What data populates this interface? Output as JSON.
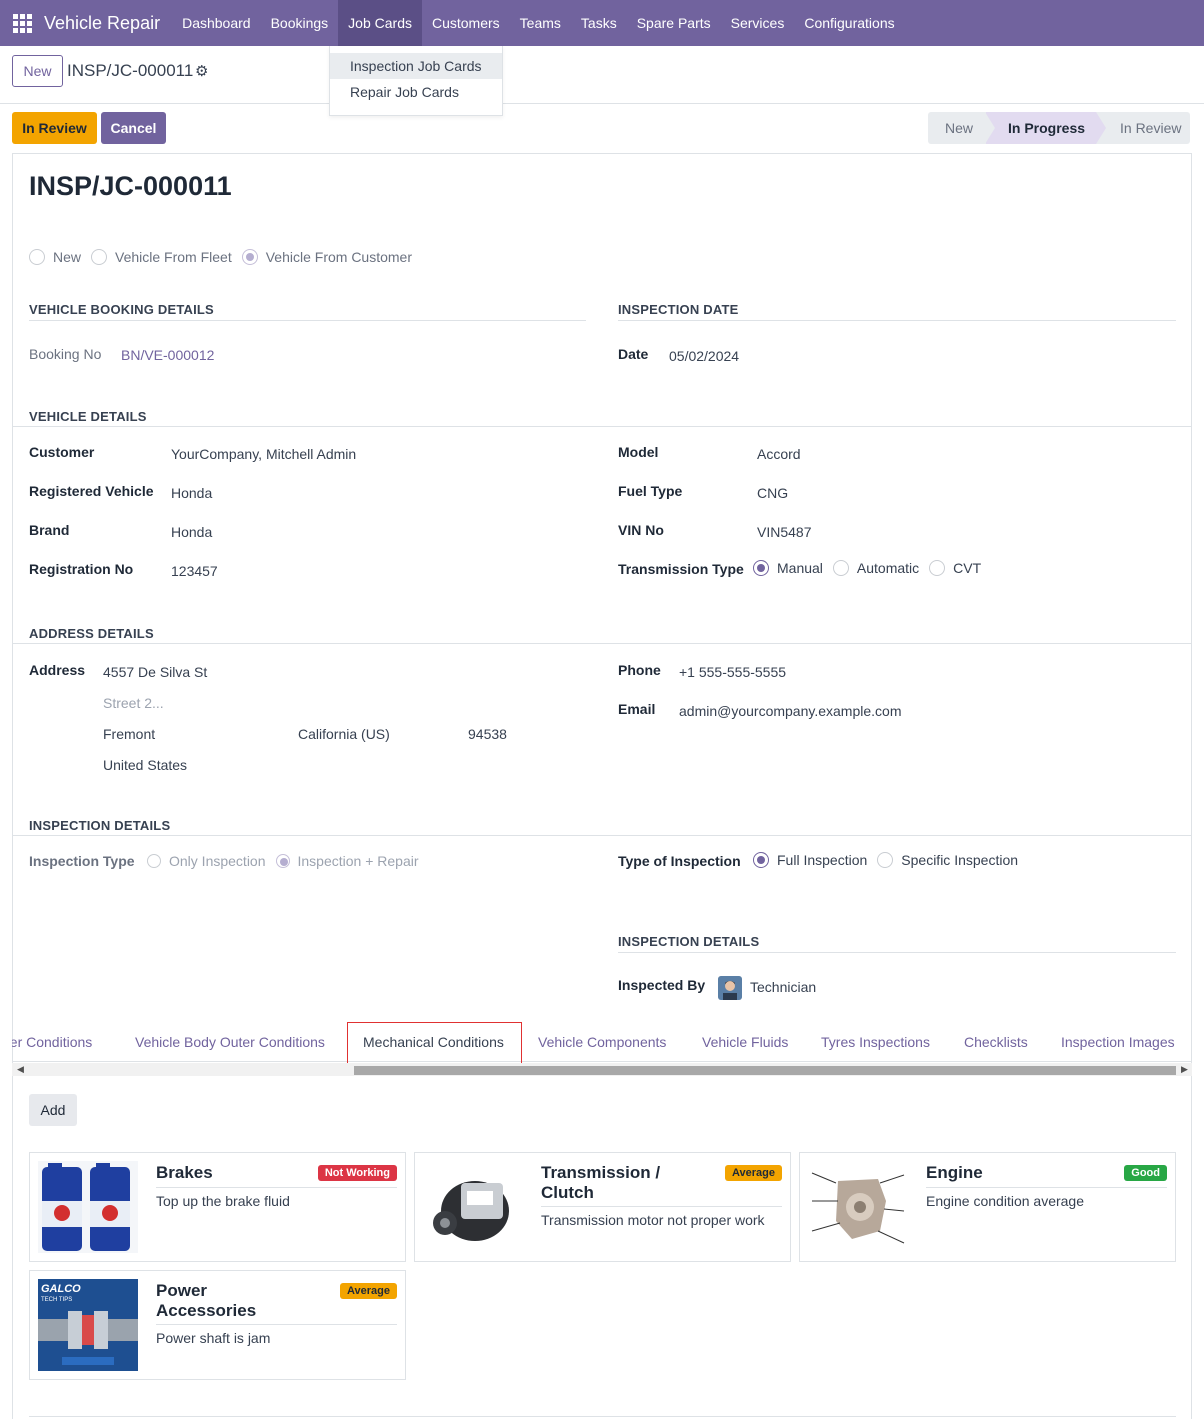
{
  "navbar": {
    "brand": "Vehicle Repair",
    "items": [
      "Dashboard",
      "Bookings",
      "Job Cards",
      "Customers",
      "Teams",
      "Tasks",
      "Spare Parts",
      "Services",
      "Configurations"
    ],
    "active_index": 2
  },
  "dropdown": {
    "items": [
      "Inspection Job Cards",
      "Repair Job Cards"
    ]
  },
  "control_panel": {
    "new_button": "New",
    "breadcrumb": "INSP/JC-000011"
  },
  "actions": {
    "in_review_button": "In Review",
    "cancel_button": "Cancel"
  },
  "statusbar": {
    "stages": [
      "New",
      "In Progress",
      "In Review"
    ],
    "current": "In Progress"
  },
  "record": {
    "title": "INSP/JC-000011",
    "vehicle_source_options": [
      "New",
      "Vehicle From Fleet",
      "Vehicle From Customer"
    ],
    "vehicle_source_selected": "Vehicle From Customer"
  },
  "booking": {
    "section": "VEHICLE BOOKING DETAILS",
    "booking_no_label": "Booking No",
    "booking_no": "BN/VE-000012"
  },
  "inspection_date": {
    "section": "INSPECTION DATE",
    "date_label": "Date",
    "date": "05/02/2024"
  },
  "vehicle": {
    "section": "VEHICLE DETAILS",
    "customer_label": "Customer",
    "customer": "YourCompany, Mitchell Admin",
    "registered_label": "Registered Vehicle",
    "registered": "Honda",
    "brand_label": "Brand",
    "brand": "Honda",
    "registration_label": "Registration No",
    "registration": "123457",
    "model_label": "Model",
    "model": "Accord",
    "fuel_label": "Fuel Type",
    "fuel": "CNG",
    "vin_label": "VIN No",
    "vin": "VIN5487",
    "transmission_label": "Transmission Type",
    "transmission_options": [
      "Manual",
      "Automatic",
      "CVT"
    ],
    "transmission_selected": "Manual"
  },
  "address": {
    "section": "ADDRESS DETAILS",
    "address_label": "Address",
    "street": "4557 De Silva St",
    "street2_placeholder": "Street 2...",
    "city": "Fremont",
    "state": "California (US)",
    "zip": "94538",
    "country": "United States",
    "phone_label": "Phone",
    "phone": "+1 555-555-5555",
    "email_label": "Email",
    "email": "admin@yourcompany.example.com"
  },
  "inspection": {
    "section": "INSPECTION DETAILS",
    "type_label": "Inspection Type",
    "type_options": [
      "Only Inspection",
      "Inspection + Repair"
    ],
    "type_selected": "Inspection + Repair",
    "kind_label": "Type of Inspection",
    "kind_options": [
      "Full Inspection",
      "Specific Inspection"
    ],
    "kind_selected": "Full Inspection",
    "section2": "INSPECTION DETAILS",
    "inspected_by_label": "Inspected By",
    "inspected_by": "Technician"
  },
  "tabs": {
    "items": [
      "ner Conditions",
      "Vehicle Body Outer Conditions",
      "Mechanical Conditions",
      "Vehicle Components",
      "Vehicle Fluids",
      "Tyres Inspections",
      "Checklists",
      "Inspection Images"
    ],
    "active": "Mechanical Conditions"
  },
  "mechanical": {
    "add_button": "Add",
    "cards": [
      {
        "title_lines": [
          "Brakes"
        ],
        "badge": "Not Working",
        "badge_color": "#dc3545",
        "description": "Top up the brake fluid",
        "image": "brake-fluid-bottles"
      },
      {
        "title_lines": [
          "Transmission /",
          "Clutch"
        ],
        "badge": "Average",
        "badge_color": "#f3a400",
        "description": "Transmission motor not proper work",
        "image": "transmission-motor"
      },
      {
        "title_lines": [
          "Engine"
        ],
        "badge": "Good",
        "badge_color": "#28a745",
        "description": "Engine condition average",
        "image": "engine-diagram"
      },
      {
        "title_lines": [
          "Power",
          "Accessories"
        ],
        "badge": "Average",
        "badge_color": "#f3a400",
        "description": "Power shaft is jam",
        "image": "power-shaft"
      }
    ],
    "power_image_text": "GALCO",
    "power_image_subtext": "TECH TIPS"
  }
}
